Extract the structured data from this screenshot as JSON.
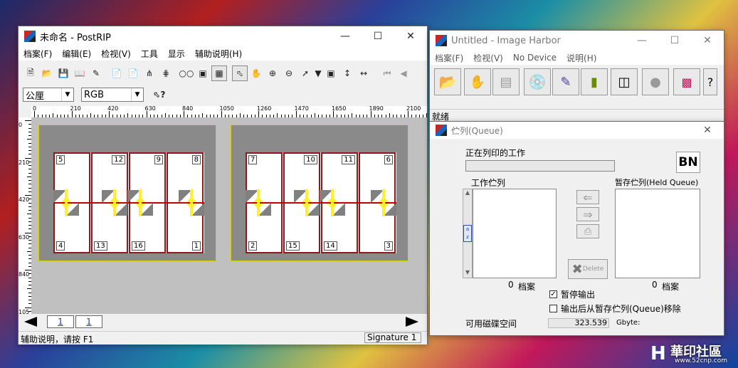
{
  "postrip": {
    "title": "未命名 - PostRIP",
    "menu": [
      "档案(F)",
      "编辑(E)",
      "检视(V)",
      "工具",
      "显示",
      "辅助说明(H)"
    ],
    "unit_select": "公厘",
    "color_select": "RGB",
    "ruler_h_labels": [
      "0",
      "210",
      "420",
      "630",
      "840",
      "1050",
      "1260",
      "1470",
      "1650",
      "1890",
      "2100"
    ],
    "ruler_v_labels": [
      "0",
      "210",
      "420",
      "630",
      "840",
      "105"
    ],
    "sheet1_pages": [
      "5",
      "12",
      "9",
      "8",
      "4",
      "13",
      "16",
      "1"
    ],
    "sheet2_pages": [
      "7",
      "10",
      "11",
      "6",
      "2",
      "15",
      "14",
      "3"
    ],
    "tab1": "1",
    "tab2": "1",
    "status_text": "辅助说明，请按 F1",
    "signature_text": "Signature 1"
  },
  "harbor": {
    "title": "Untitled - Image Harbor",
    "menu": [
      "档案(F)",
      "检视(V)",
      "No Device",
      "说明(H)"
    ],
    "status": "就绪"
  },
  "queue": {
    "title": "伫列(Queue)",
    "printing_label": "正在列印的工作",
    "bn_label": "BN",
    "work_queue_label": "工作伫列",
    "held_queue_label": "暂存伫列(Held Queue)",
    "work_count": "0",
    "work_unit": "档案",
    "held_count": "0",
    "held_unit": "档案",
    "delete_label": "Delete",
    "pause_label": "暂停输出",
    "pause_checked": true,
    "remove_label": "输出后从暂存伫列(Queue)移除",
    "remove_checked": false,
    "disk_label": "可用磁碟空间",
    "disk_value": "323.539",
    "disk_unit": "Gbyte:"
  },
  "watermark": {
    "text": "華印社區",
    "url": "www.52cnp.com"
  },
  "colors": {
    "page_border": "#8b1a1a",
    "guide_red": "#c00000",
    "sheet_gray": "#8a8a8a",
    "sheet_outline": "#d4d000",
    "arrow_yellow": "#ffef30"
  }
}
